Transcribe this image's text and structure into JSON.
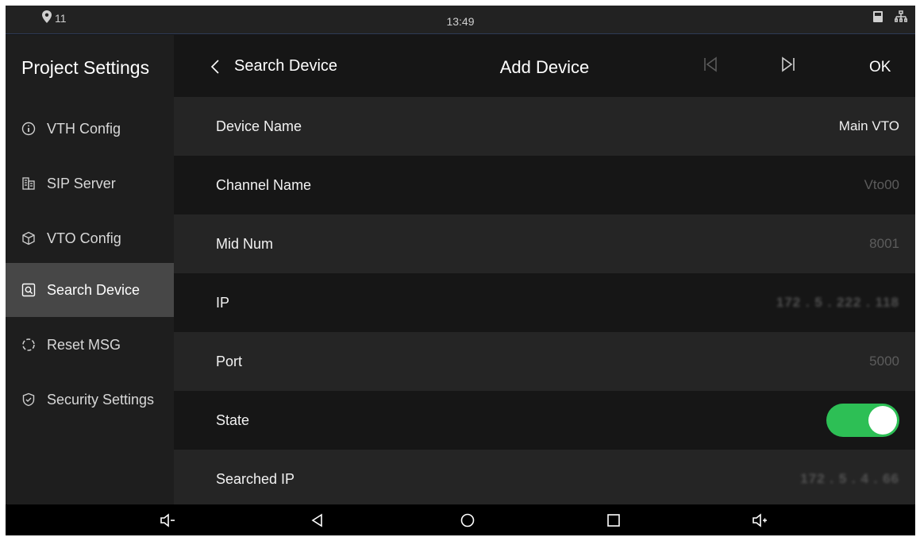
{
  "status": {
    "notification_count": "11",
    "time": "13:49",
    "icons": [
      "location-pin-icon",
      "sd-card-icon",
      "network-icon"
    ]
  },
  "sidebar": {
    "title": "Project Settings",
    "items": [
      {
        "label": "VTH Config",
        "icon": "info-icon",
        "active": false
      },
      {
        "label": "SIP Server",
        "icon": "building-icon",
        "active": false
      },
      {
        "label": "VTO Config",
        "icon": "cube-icon",
        "active": false
      },
      {
        "label": "Search Device",
        "icon": "search-icon",
        "active": true
      },
      {
        "label": "Reset MSG",
        "icon": "reset-icon",
        "active": false
      },
      {
        "label": "Security Settings",
        "icon": "shield-icon",
        "active": false
      }
    ]
  },
  "header": {
    "back_label": "Search Device",
    "title": "Add Device",
    "ok_label": "OK"
  },
  "form": {
    "rows": [
      {
        "label": "Device Name",
        "value": "Main VTO"
      },
      {
        "label": "Channel Name",
        "value": "Vto00"
      },
      {
        "label": "Mid Num",
        "value": "8001"
      },
      {
        "label": "IP",
        "value": "172 . 5 . 222 . 118"
      },
      {
        "label": "Port",
        "value": "5000"
      },
      {
        "label": "State",
        "value": "on"
      },
      {
        "label": "Searched IP",
        "value": "172 . 5 . 4 . 66"
      }
    ]
  },
  "colors": {
    "background": "#161616",
    "sidebar": "#1e1e1e",
    "active_item": "#474747",
    "toggle_on": "#2dbf55"
  },
  "navbar": {
    "icons": [
      "volume-down-icon",
      "back-triangle-icon",
      "home-circle-icon",
      "recents-square-icon",
      "volume-up-icon"
    ]
  }
}
